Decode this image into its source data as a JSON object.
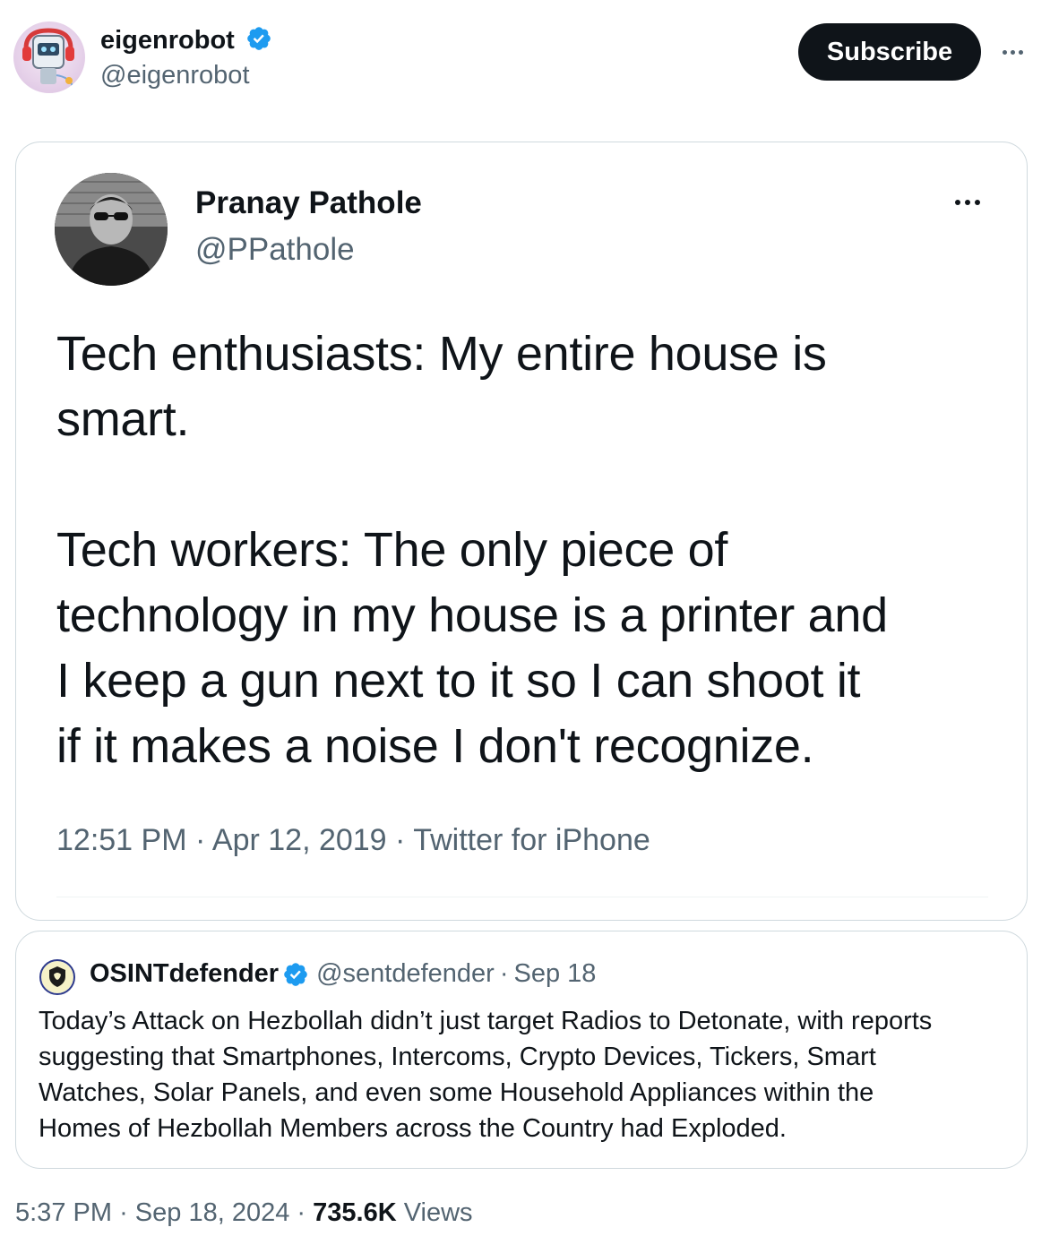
{
  "author": {
    "name": "eigenrobot",
    "handle": "@eigenrobot",
    "verified": true
  },
  "actions": {
    "subscribe_label": "Subscribe",
    "more_icon": "more-horizontal-icon"
  },
  "embedded_tweet": {
    "name": "Pranay Pathole",
    "handle": "@PPathole",
    "text_lines_1": [
      "Tech enthusiasts: My entire house is",
      "smart."
    ],
    "text_lines_2": [
      "Tech workers: The only piece of",
      "technology in my house is a printer and",
      "I keep a gun next to it so I can shoot it",
      "if it makes a noise I don't recognize."
    ],
    "time": "12:51 PM",
    "date": "Apr 12, 2019",
    "source": "Twitter for iPhone",
    "separator": "·"
  },
  "quoted_tweet": {
    "name": "OSINTdefender",
    "handle": "@sentdefender",
    "date": "Sep 18",
    "separator": "·",
    "verified": true,
    "text_lines": [
      "Today’s Attack on Hezbollah didn’t just target Radios to Detonate, with reports",
      "suggesting that Smartphones, Intercoms, Crypto Devices, Tickers, Smart",
      "Watches, Solar Panels, and even some Household Appliances within the",
      "Homes of Hezbollah Members across the Country had Exploded."
    ]
  },
  "footer": {
    "time": "5:37 PM",
    "date": "Sep 18, 2024",
    "separator": "·",
    "views_count": "735.6K",
    "views_label": "Views"
  },
  "colors": {
    "text_primary": "#0f1419",
    "text_secondary": "#536471",
    "verified_blue": "#1d9bf0",
    "border": "#cfd9de",
    "button_bg": "#0f1419"
  }
}
